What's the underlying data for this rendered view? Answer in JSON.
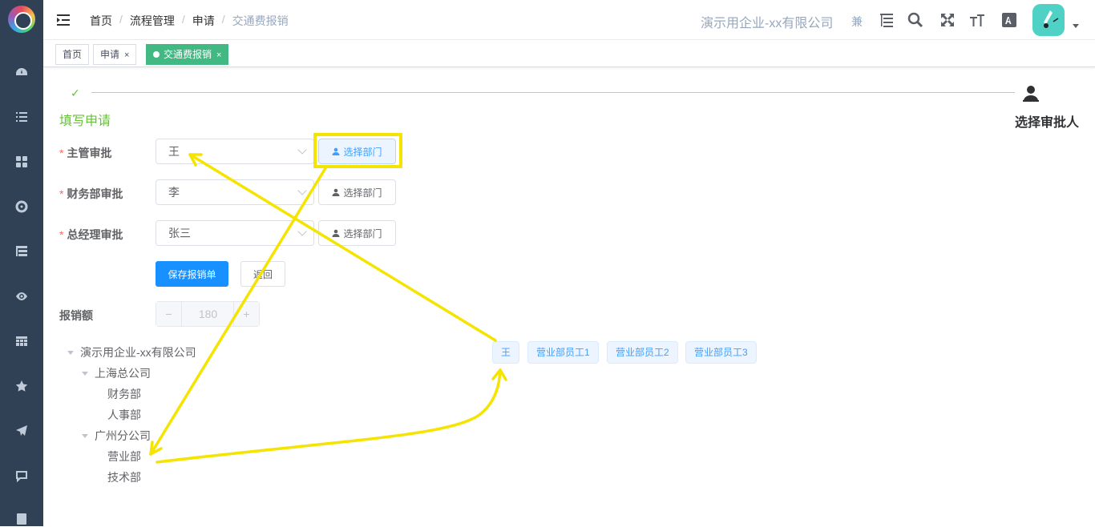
{
  "breadcrumb": [
    "首页",
    "流程管理",
    "申请",
    "交通费报销"
  ],
  "header": {
    "company": "演示用企业-xx有限公司",
    "role": "兼"
  },
  "tags": [
    {
      "label": "首页"
    },
    {
      "label": "申请",
      "close": "×"
    },
    {
      "label": "交通费报销",
      "close": "×",
      "active": true
    }
  ],
  "steps": {
    "step1": "填写申请",
    "step2": "选择审批人",
    "check": "✓"
  },
  "form": {
    "supervisor": {
      "label": "主管审批",
      "value": "王",
      "button": "选择部门"
    },
    "finance": {
      "label": "财务部审批",
      "value": "李",
      "button": "选择部门"
    },
    "gm": {
      "label": "总经理审批",
      "value": "张三",
      "button": "选择部门"
    },
    "required_mark": "*",
    "save": "保存报销单",
    "back": "返回",
    "amount_label": "报销额",
    "amount": "180",
    "minus": "−",
    "plus": "+"
  },
  "tree": {
    "root": "演示用企业-xx有限公司",
    "shanghai": "上海总公司",
    "finance_dept": "财务部",
    "hr_dept": "人事部",
    "guangzhou": "广州分公司",
    "sales_dept": "营业部",
    "tech_dept": "技术部"
  },
  "employees": [
    "王",
    "营业部员工1",
    "营业部员工2",
    "营业部员工3"
  ],
  "colors": {
    "sidebar": "#304156",
    "primary": "#1890ff",
    "active_tag": "#42b983",
    "highlight": "#f5e400"
  },
  "icons": [
    "logo",
    "dashboard-icon",
    "list-icon",
    "grid-icon",
    "target-icon",
    "tree-list-icon",
    "eye-icon",
    "table-icon",
    "star-icon",
    "send-icon",
    "chat-icon",
    "book-icon",
    "hamburger-icon",
    "sitemap-icon",
    "search-icon",
    "fullscreen-icon",
    "font-size-icon",
    "translate-icon",
    "user-icon"
  ]
}
